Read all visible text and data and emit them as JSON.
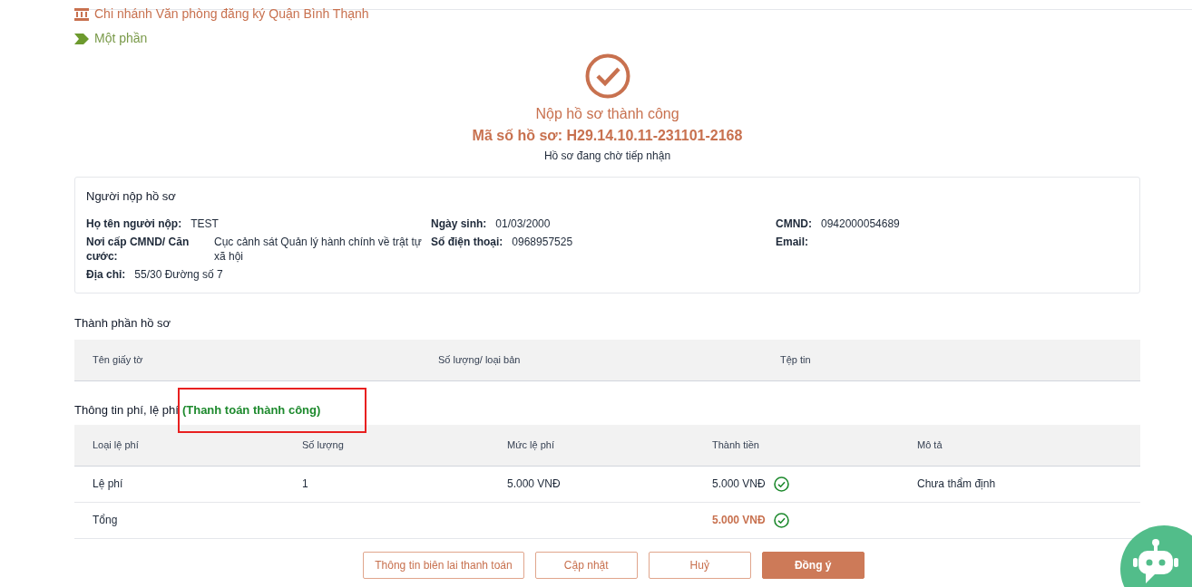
{
  "header": {
    "office": "Chi nhánh Văn phòng đăng ký Quận Bình Thạnh",
    "status": "Một phần"
  },
  "result": {
    "title": "Nộp hồ sơ thành công",
    "code": "Mã số hồ sơ: H29.14.10.11-231101-2168",
    "subtitle": "Hồ sơ đang chờ tiếp nhận"
  },
  "applicant": {
    "title": "Người nộp hồ sơ",
    "columns": [
      [
        {
          "label": "Họ tên người nộp:",
          "value": "TEST"
        },
        {
          "label": "Nơi cấp CMND/ Căn cước:",
          "value": "Cục cảnh sát Quản lý hành chính về trật tự xã hội"
        },
        {
          "label": "Địa chỉ:",
          "value": "55/30 Đường số 7"
        }
      ],
      [
        {
          "label": "Ngày sinh:",
          "value": "01/03/2000"
        },
        {
          "label": "Số điện thoại:",
          "value": "0968957525"
        }
      ],
      [
        {
          "label": "CMND:",
          "value": "0942000054689"
        },
        {
          "label": "Email:"
        }
      ]
    ]
  },
  "documents": {
    "title": "Thành phần hồ sơ",
    "columns": [
      "Tên giấy tờ",
      "Số lượng/ loại bản",
      "Tệp tin"
    ]
  },
  "fees": {
    "title": "Thông tin phí, lệ phí",
    "status": "(Thanh toán thành công)",
    "columns": [
      "Loại lệ phí",
      "Số lượng",
      "Mức lệ phí",
      "Thành tiền",
      "Mô tả"
    ],
    "rows": [
      {
        "kind": "item",
        "cells": [
          "Lệ phí",
          "1",
          "5.000 VNĐ",
          "5.000 VNĐ",
          "Chưa thẩm định"
        ],
        "paid": true
      },
      {
        "kind": "total",
        "cells": [
          "Tổng",
          "",
          "",
          "5.000 VNĐ",
          ""
        ],
        "paid": true
      }
    ]
  },
  "buttons": [
    {
      "label": "Thông tin biên lai thanh toán",
      "kind": "outline"
    },
    {
      "label": "Cập nhật",
      "kind": "outline"
    },
    {
      "label": "Huỷ",
      "kind": "outline"
    },
    {
      "label": "Đồng ý",
      "kind": "primary"
    }
  ]
}
